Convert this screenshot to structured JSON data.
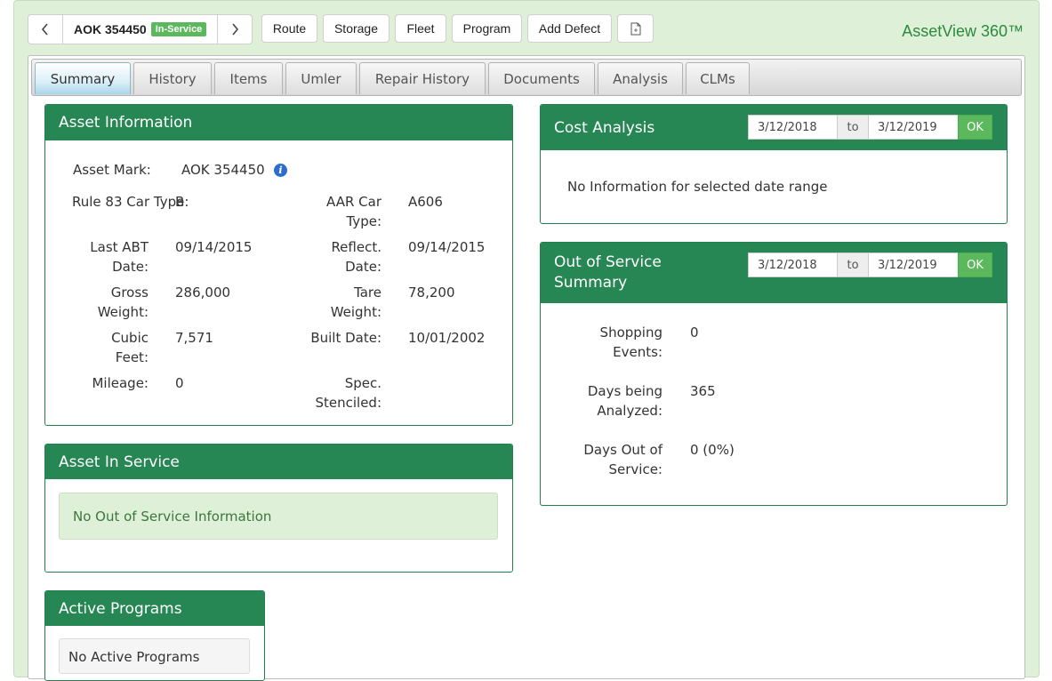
{
  "header": {
    "asset_id": "AOK 354450",
    "status_badge": "In-Service",
    "buttons": [
      "Route",
      "Storage",
      "Fleet",
      "Program",
      "Add Defect"
    ],
    "brand": "AssetView 360™"
  },
  "tabs": [
    "Summary",
    "History",
    "Items",
    "Umler",
    "Repair History",
    "Documents",
    "Analysis",
    "CLMs"
  ],
  "asset_information": {
    "title": "Asset Information",
    "asset_mark_label": "Asset Mark:",
    "asset_mark_value": "AOK 354450",
    "rule83_label": "Rule 83 Car Type:",
    "rule83_value": "B",
    "aar_label_1": "AAR Car",
    "aar_label_2": "Type:",
    "aar_value": "A606",
    "last_abt_label_1": "Last ABT",
    "last_abt_label_2": "Date:",
    "last_abt_value": "09/14/2015",
    "reflect_label_1": "Reflect.",
    "reflect_label_2": "Date:",
    "reflect_value": "09/14/2015",
    "gross_label_1": "Gross",
    "gross_label_2": "Weight:",
    "gross_value": "286,000",
    "tare_label_1": "Tare",
    "tare_label_2": "Weight:",
    "tare_value": "78,200",
    "cubic_label_1": "Cubic",
    "cubic_label_2": "Feet:",
    "cubic_value": "7,571",
    "built_label": "Built Date:",
    "built_value": "10/01/2002",
    "mileage_label": "Mileage:",
    "mileage_value": "0",
    "spec_label_1": "Spec.",
    "spec_label_2": "Stenciled:",
    "spec_value": ""
  },
  "asset_in_service": {
    "title": "Asset In Service",
    "message": "No Out of Service Information"
  },
  "active_programs": {
    "title": "Active Programs",
    "message": "No Active Programs"
  },
  "cost_analysis": {
    "title": "Cost Analysis",
    "from_date": "3/12/2018",
    "to_label": "to",
    "to_date": "3/12/2019",
    "ok_label": "OK",
    "message": "No Information for selected date range"
  },
  "out_of_service": {
    "title_1": "Out of Service",
    "title_2": "Summary",
    "from_date": "3/12/2018",
    "to_label": "to",
    "to_date": "3/12/2019",
    "ok_label": "OK",
    "shopping_label_1": "Shopping",
    "shopping_label_2": "Events:",
    "shopping_value": "0",
    "days_analyzed_label_1": "Days being",
    "days_analyzed_label_2": "Analyzed:",
    "days_analyzed_value": "365",
    "days_out_label_1": "Days Out of",
    "days_out_label_2": "Service:",
    "days_out_value": "0 (0%)"
  },
  "colors": {
    "header_green": "#268754",
    "badge_green": "#5cb85c",
    "background_green": "#dff0d8",
    "brand_green": "#2a8a3e"
  },
  "icons": [
    "chevron-left-icon",
    "chevron-right-icon",
    "document-icon",
    "info-icon"
  ]
}
